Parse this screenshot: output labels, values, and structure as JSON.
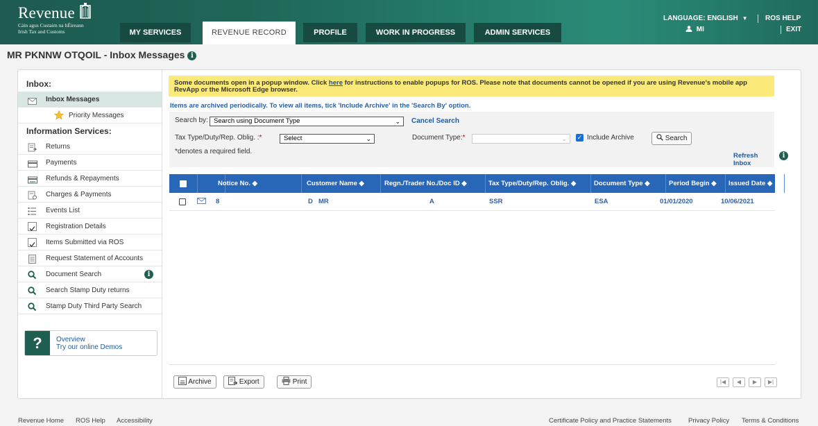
{
  "header": {
    "logo_word": "Revenue",
    "logo_sub1": "Cáin agus Custaim na hÉireann",
    "logo_sub2": "Irish Tax and Customs",
    "tabs": [
      {
        "label": "MY SERVICES"
      },
      {
        "label": "REVENUE RECORD"
      },
      {
        "label": "PROFILE"
      },
      {
        "label": "WORK IN PROGRESS"
      },
      {
        "label": "ADMIN SERVICES"
      }
    ],
    "language": "LANGUAGE: ENGLISH",
    "ros_help": "ROS HELP",
    "user": "MI",
    "exit": "EXIT"
  },
  "page": {
    "title": "MR PKNNW OTQOIL - Inbox Messages"
  },
  "sidebar": {
    "inbox_heading": "Inbox:",
    "inbox_items": [
      {
        "label": "Inbox Messages"
      },
      {
        "label": "Priority Messages"
      }
    ],
    "info_heading": "Information Services:",
    "info_items": [
      {
        "label": "Returns"
      },
      {
        "label": "Payments"
      },
      {
        "label": "Refunds & Repayments"
      },
      {
        "label": "Charges & Payments"
      },
      {
        "label": "Events List"
      },
      {
        "label": "Registration Details"
      },
      {
        "label": "Items Submitted via ROS"
      },
      {
        "label": "Request Statement of Accounts"
      },
      {
        "label": "Document Search"
      },
      {
        "label": "Search Stamp Duty returns"
      },
      {
        "label": "Stamp Duty Third Party Search"
      }
    ],
    "demo": {
      "line1": "Overview",
      "line2": "Try our online Demos"
    }
  },
  "notice": {
    "before_link": "Some documents open in a popup window. Click ",
    "link": "here",
    "after_link": " for instructions to enable popups for ROS. Please note that documents cannot be opened if you are using Revenue's mobile app RevApp or the Microsoft Edge browser.",
    "archive_note": "Items are archived periodically. To view all items, tick 'Include Archive' in the 'Search By' option."
  },
  "filter": {
    "search_by_label": "Search by:",
    "search_by_value": "Search using Document Type",
    "cancel_search": "Cancel Search",
    "tax_type_label": "Tax Type/Duty/Rep. Oblig. :",
    "tax_type_value": "Select",
    "doc_type_label": "Document Type:",
    "doc_type_value": "",
    "include_archive": "Include Archive",
    "include_archive_checked": true,
    "search_button": "Search",
    "required_note": "*denotes a required field.",
    "refresh_inbox": "Refresh Inbox"
  },
  "table": {
    "columns": [
      "Notice No. ◆",
      "Customer Name ◆",
      "Regn./Trader No./Doc ID ◆",
      "Tax Type/Duty/Rep. Oblig. ◆",
      "Document Type ◆",
      "Period Begin ◆",
      "Issued Date ◆"
    ],
    "rows": [
      {
        "notice_no": "8",
        "notice_suffix": "D",
        "customer_name": "MR",
        "regn": "A",
        "tax_type": "SSR",
        "doc_type": "ESA",
        "period_begin": "01/01/2020",
        "issued_date": "10/06/2021"
      }
    ]
  },
  "actions": {
    "archive": "Archive",
    "export": "Export",
    "print": "Print"
  },
  "pager": [
    "|◀",
    "◀",
    "▶",
    "▶|"
  ],
  "footer": {
    "left": [
      "Revenue Home",
      "ROS Help",
      "Accessibility"
    ],
    "right": [
      "Certificate Policy and Practice Statements",
      "Privacy Policy",
      "Terms & Conditions"
    ]
  },
  "colors": {
    "brand_green": "#1f6657",
    "header_blue": "#2866b8",
    "notice_yellow": "#fbe97a",
    "link_blue": "#1f5a9e"
  }
}
